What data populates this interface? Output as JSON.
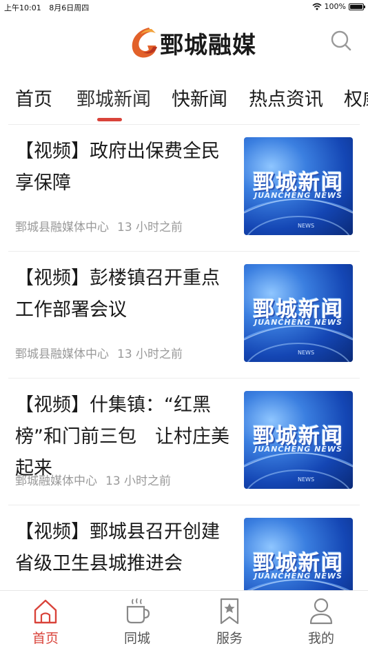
{
  "status": {
    "time": "上午10:01",
    "date": "8月6日周四",
    "battery": "100%",
    "battery_level": 1.0
  },
  "header": {
    "logo_text": "鄄城融媒",
    "logo_icon": "logo-flame-icon",
    "search_icon": "search-icon"
  },
  "tabs": [
    {
      "label": "首页"
    },
    {
      "label": "鄄城新闻"
    },
    {
      "label": "快新闻"
    },
    {
      "label": "热点资讯"
    },
    {
      "label": "权威"
    }
  ],
  "active_tab": 1,
  "thumbnail": {
    "title": "鄄城新闻",
    "subtitle": "JUANCHENG NEWS",
    "small": "NEWS"
  },
  "feed": [
    {
      "title": "【视频】政府出保费全民享保障",
      "source": "鄄城县融媒体中心",
      "time": "13 小时之前"
    },
    {
      "title": "【视频】彭楼镇召开重点工作部署会议",
      "source": "鄄城县融媒体中心",
      "time": "13 小时之前"
    },
    {
      "title": "【视频】什集镇：“红黑榜”和门前三包　让村庄美起来",
      "source": "鄄城融媒体中心",
      "time": "13 小时之前"
    },
    {
      "title": "【视频】鄄城县召开创建省级卫生县城推进会",
      "source": "",
      "time": ""
    }
  ],
  "tabbar": [
    {
      "label": "首页",
      "icon": "home-icon"
    },
    {
      "label": "同城",
      "icon": "coffee-cup-icon"
    },
    {
      "label": "服务",
      "icon": "bookmark-star-icon"
    },
    {
      "label": "我的",
      "icon": "user-icon"
    }
  ],
  "colors": {
    "accent": "#d9433a",
    "meta_text": "#999999"
  }
}
